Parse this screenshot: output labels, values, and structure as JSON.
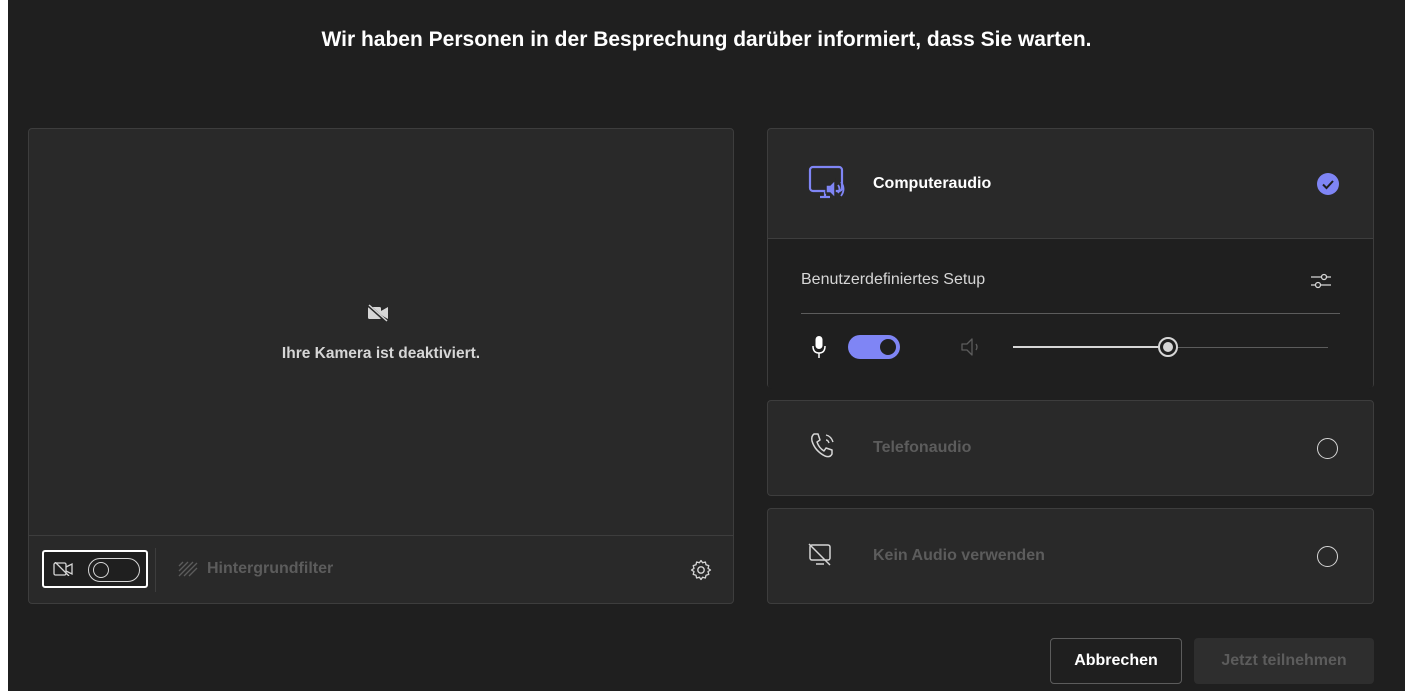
{
  "header": {
    "title": "Wir haben Personen in der Besprechung darüber informiert, dass Sie warten."
  },
  "video_preview": {
    "camera_off_text": "Ihre Kamera ist deaktiviert.",
    "camera_toggle_on": false,
    "background_filter_label": "Hintergrundfilter",
    "camera_off_icon": "video-off-icon",
    "settings_icon": "gear-icon"
  },
  "audio_options": {
    "computer_audio": {
      "label": "Computeraudio",
      "selected": true,
      "icon": "computer-speaker-icon",
      "custom_setup_label": "Benutzerdefiniertes Setup",
      "mic_on": true,
      "speaker_volume": 0.5
    },
    "phone_audio": {
      "label": "Telefonaudio",
      "selected": false,
      "icon": "phone-call-icon"
    },
    "no_audio": {
      "label": "Kein Audio verwenden",
      "selected": false,
      "icon": "no-audio-screen-icon"
    }
  },
  "buttons": {
    "cancel_label": "Abbrechen",
    "join_label": "Jetzt teilnehmen"
  },
  "colors": {
    "accent": "#7f85f5",
    "background": "#1f1f1f",
    "panel": "#292929"
  }
}
